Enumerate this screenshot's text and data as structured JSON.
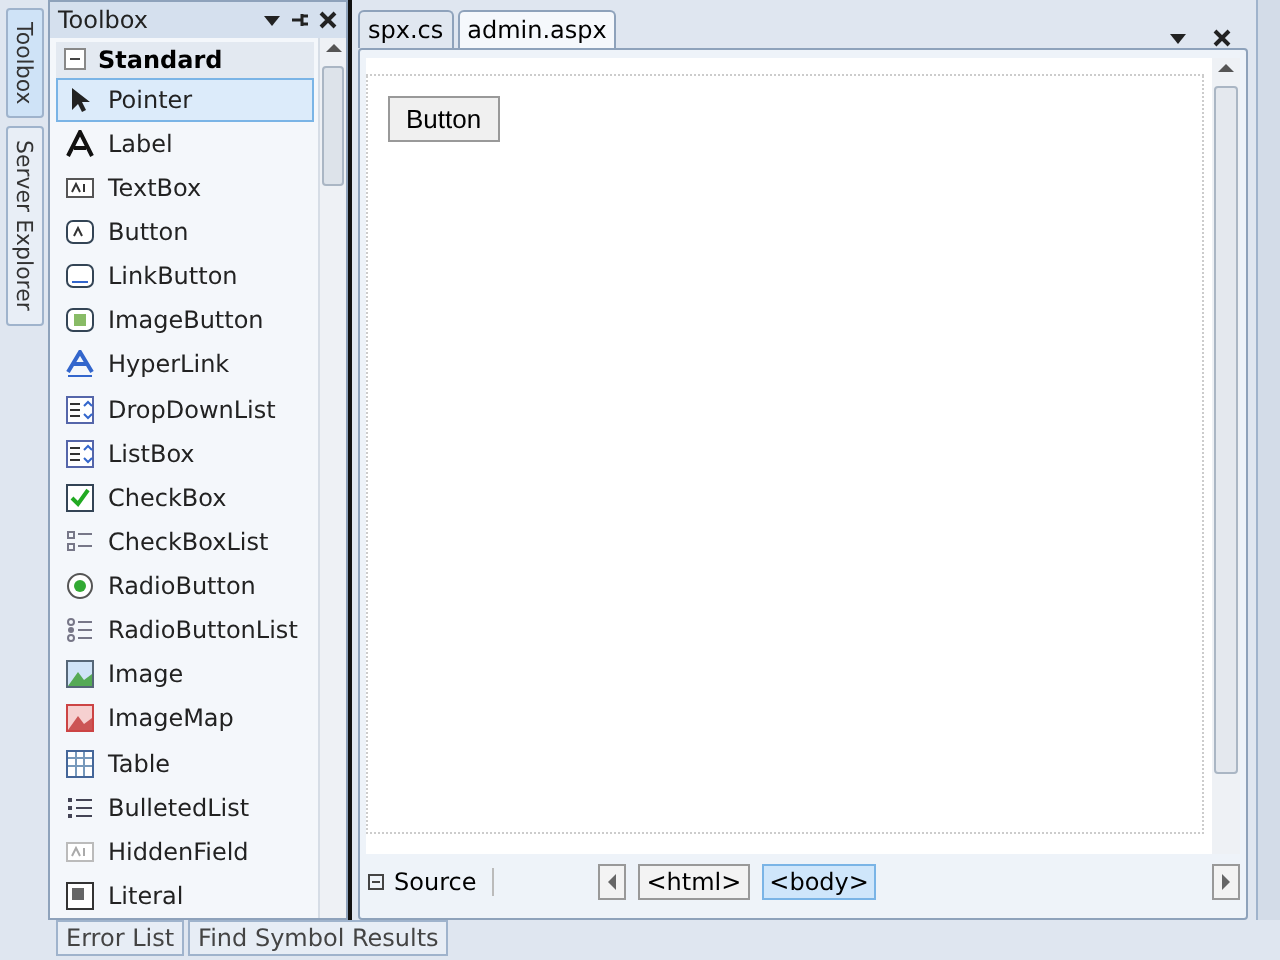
{
  "side_tabs": [
    {
      "label": "Toolbox",
      "selected": true
    },
    {
      "label": "Server Explorer",
      "selected": false
    }
  ],
  "toolbox": {
    "title": "Toolbox",
    "group": {
      "label": "Standard",
      "expanded": true,
      "items": [
        {
          "label": "Pointer",
          "selected": true
        },
        {
          "label": "Label",
          "selected": false
        },
        {
          "label": "TextBox",
          "selected": false
        },
        {
          "label": "Button",
          "selected": false
        },
        {
          "label": "LinkButton",
          "selected": false
        },
        {
          "label": "ImageButton",
          "selected": false
        },
        {
          "label": "HyperLink",
          "selected": false
        },
        {
          "label": "DropDownList",
          "selected": false
        },
        {
          "label": "ListBox",
          "selected": false
        },
        {
          "label": "CheckBox",
          "selected": false
        },
        {
          "label": "CheckBoxList",
          "selected": false
        },
        {
          "label": "RadioButton",
          "selected": false
        },
        {
          "label": "RadioButtonList",
          "selected": false
        },
        {
          "label": "Image",
          "selected": false
        },
        {
          "label": "ImageMap",
          "selected": false
        },
        {
          "label": "Table",
          "selected": false
        },
        {
          "label": "BulletedList",
          "selected": false
        },
        {
          "label": "HiddenField",
          "selected": false
        },
        {
          "label": "Literal",
          "selected": false
        }
      ]
    }
  },
  "editor": {
    "tabs": [
      {
        "label": "spx.cs",
        "selected": false
      },
      {
        "label": "admin.aspx",
        "selected": true
      }
    ],
    "design_button": "Button",
    "view_tab": "Source",
    "breadcrumbs": [
      {
        "label": "<html>",
        "selected": false
      },
      {
        "label": "<body>",
        "selected": true
      }
    ]
  },
  "bottom_tabs": [
    {
      "label": "Error List"
    },
    {
      "label": "Find Symbol Results"
    }
  ]
}
